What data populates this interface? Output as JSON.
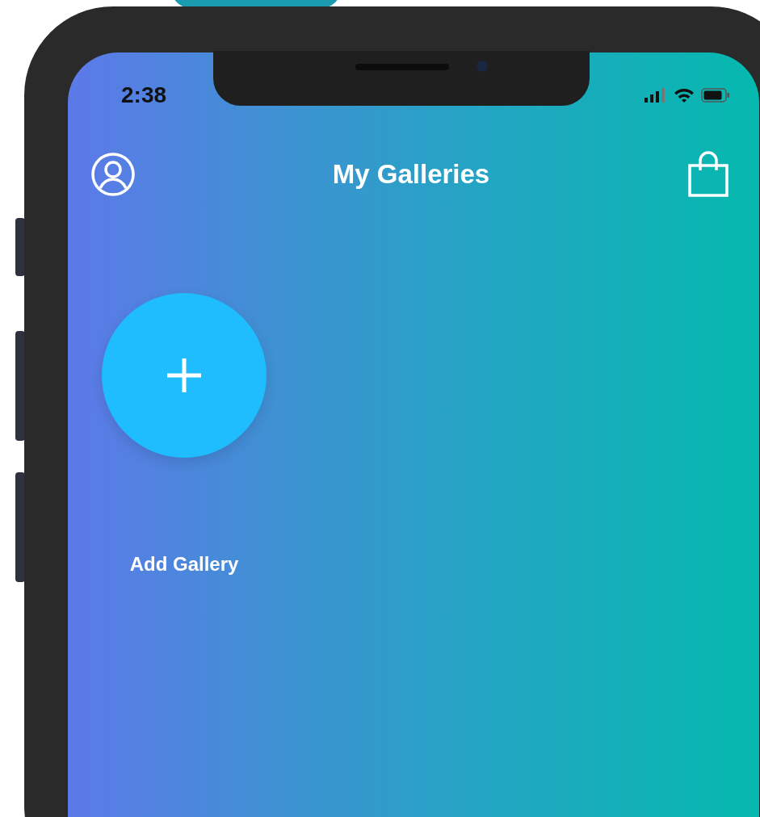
{
  "status_bar": {
    "time": "2:38"
  },
  "header": {
    "title": "My Galleries"
  },
  "galleries": [
    {
      "kind": "add",
      "label": "Add Gallery"
    }
  ]
}
